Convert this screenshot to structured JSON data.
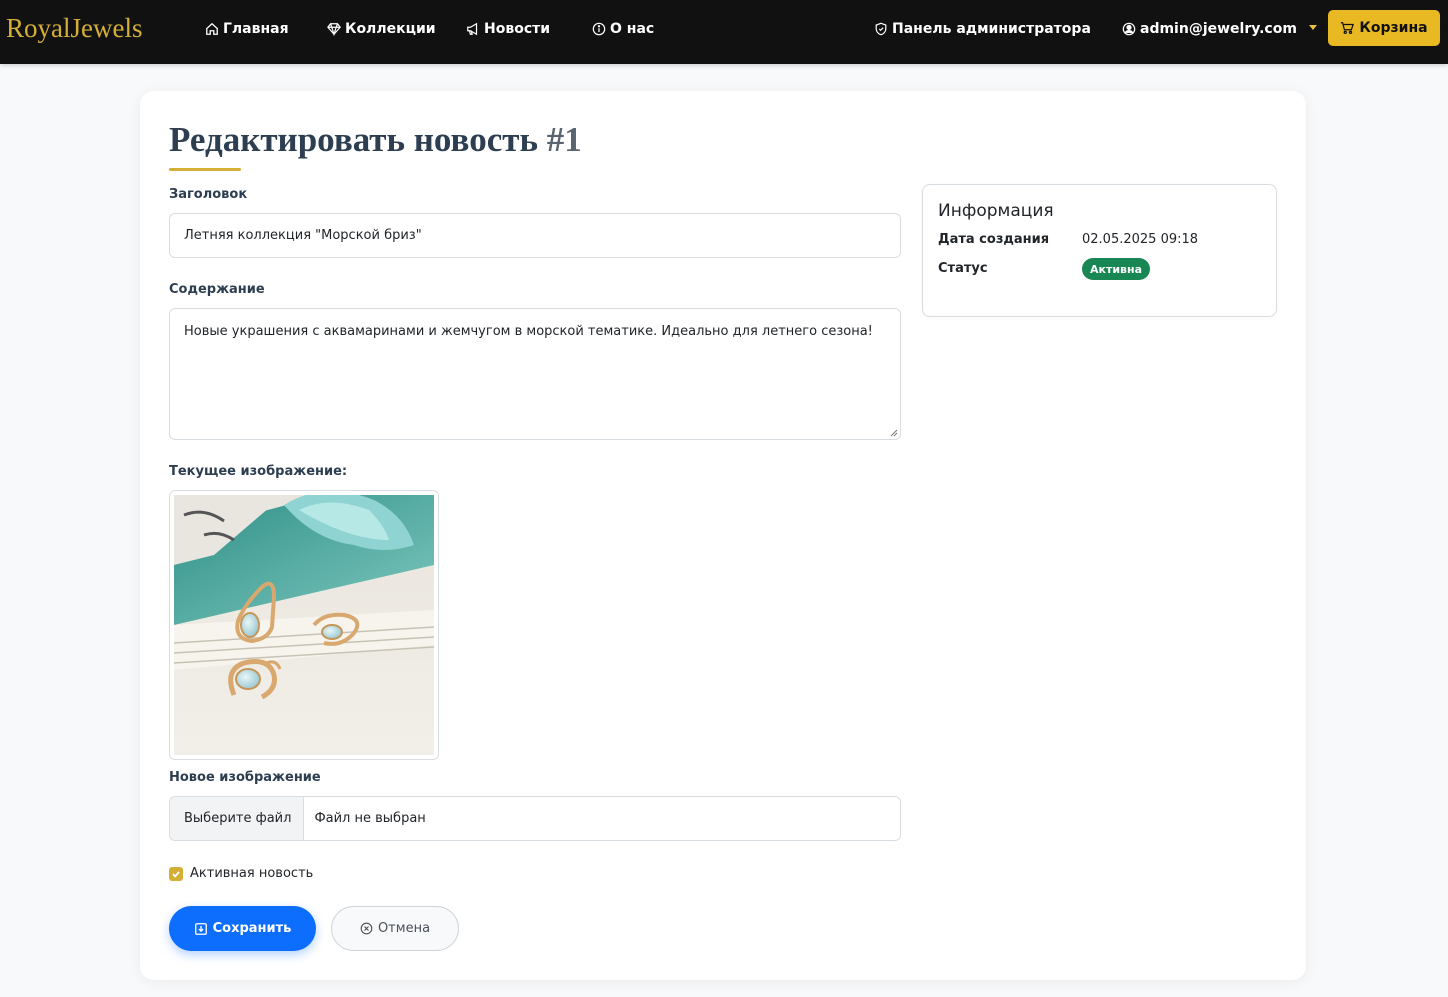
{
  "nav": {
    "brand": "RoyalJewels",
    "home": "Главная",
    "collections": "Коллекции",
    "news": "Новости",
    "about": "О нас",
    "admin_panel": "Панель администратора",
    "user_email": "admin@jewelry.com",
    "cart": "Корзина"
  },
  "page": {
    "title_main": "Редактировать новость",
    "title_id": "#1"
  },
  "form": {
    "title_label": "Заголовок",
    "title_value": "Летняя коллекция \"Морской бриз\"",
    "content_label": "Содержание",
    "content_value": "Новые украшения с аквамаринами и жемчугом в морской тематике. Идеально для летнего сезона!",
    "current_image_label": "Текущее изображение:",
    "new_image_label": "Новое изображение",
    "file_button": "Выберите файл",
    "file_status": "Файл не выбран",
    "active_label": "Активная новость",
    "active_checked": true,
    "save_label": "Сохранить",
    "cancel_label": "Отмена"
  },
  "info": {
    "title": "Информация",
    "created_key": "Дата создания",
    "created_value": "02.05.2025 09:18",
    "status_key": "Статус",
    "status_value": "Активна"
  },
  "colors": {
    "accent_gold": "#d4af37",
    "cart_yellow": "#e8b923",
    "primary_blue": "#0d6efd",
    "success_green": "#198754",
    "navbar_bg": "#111111"
  },
  "icons": {
    "home": "house-icon",
    "collections": "gem-icon",
    "news": "megaphone-icon",
    "about": "info-circle-icon",
    "admin": "shield-icon",
    "user": "person-circle-icon",
    "cart": "cart-icon",
    "save": "download-icon",
    "cancel": "x-circle-icon"
  }
}
